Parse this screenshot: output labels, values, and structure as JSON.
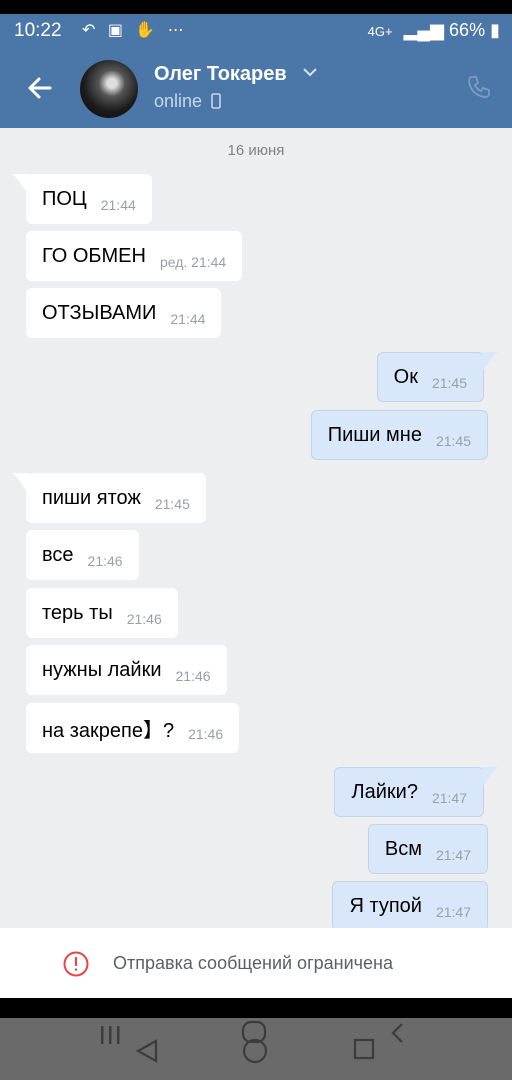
{
  "status_bar": {
    "time": "10:22",
    "left_icons": "↶ ▣ ✋ ⋯",
    "network": "4G+",
    "battery": "66%"
  },
  "header": {
    "contact_name": "Олег Токарев",
    "status": "online"
  },
  "chat": {
    "date": "16 июня",
    "messages": [
      {
        "dir": "in",
        "text": "ПОЦ",
        "time": "21:44",
        "tail": true
      },
      {
        "dir": "in",
        "text": "ГО ОБМЕН",
        "time": "ред. 21:44",
        "tail": false
      },
      {
        "dir": "in",
        "text": "ОТЗЫВАМИ",
        "time": "21:44",
        "tail": false
      },
      {
        "dir": "out",
        "text": "Ок",
        "time": "21:45",
        "tail": true
      },
      {
        "dir": "out",
        "text": "Пиши мне",
        "time": "21:45",
        "tail": false
      },
      {
        "dir": "in",
        "text": "пиши  ятож",
        "time": "21:45",
        "tail": true
      },
      {
        "dir": "in",
        "text": "все",
        "time": "21:46",
        "tail": false
      },
      {
        "dir": "in",
        "text": "терь ты",
        "time": "21:46",
        "tail": false
      },
      {
        "dir": "in",
        "text": "нужны лайки",
        "time": "21:46",
        "tail": false
      },
      {
        "dir": "in",
        "text": "на закрепе】?",
        "time": "21:46",
        "tail": false
      },
      {
        "dir": "out",
        "text": "Лайки?",
        "time": "21:47",
        "tail": true
      },
      {
        "dir": "out",
        "text": "Всм",
        "time": "21:47",
        "tail": false
      },
      {
        "dir": "out",
        "text": "Я тупой",
        "time": "21:47",
        "tail": false
      }
    ]
  },
  "restriction": {
    "text": "Отправка сообщений ограничена"
  },
  "colors": {
    "header": "#4a76a8",
    "chat_bg": "#edeef0",
    "in_bubble": "#ffffff",
    "out_bubble": "#d9e7fa",
    "warning": "#e64646"
  }
}
